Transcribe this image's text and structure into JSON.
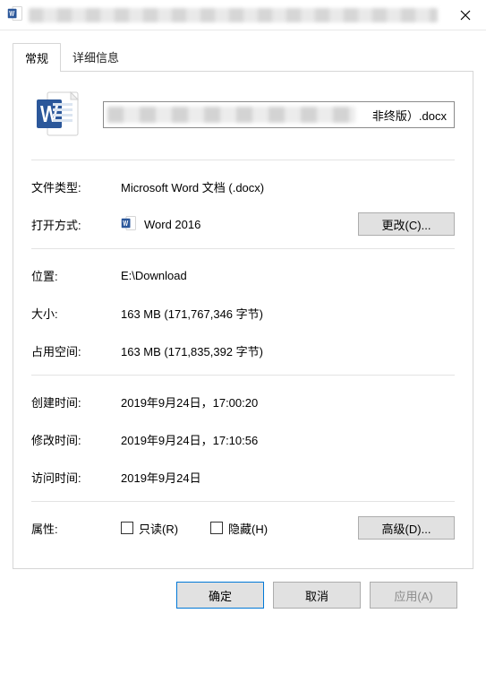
{
  "window": {
    "close_label": "✕"
  },
  "tabs": {
    "general": "常规",
    "details": "详细信息"
  },
  "filename_visible": "非终版）.docx",
  "fields": {
    "type_label": "文件类型:",
    "type_value": "Microsoft Word 文档 (.docx)",
    "open_with_label": "打开方式:",
    "open_with_value": "Word 2016",
    "change_btn": "更改(C)...",
    "location_label": "位置:",
    "location_value": "E:\\Download",
    "size_label": "大小:",
    "size_value": "163 MB (171,767,346 字节)",
    "size_on_disk_label": "占用空间:",
    "size_on_disk_value": "163 MB (171,835,392 字节)",
    "created_label": "创建时间:",
    "created_value": "2019年9月24日，17:00:20",
    "modified_label": "修改时间:",
    "modified_value": "2019年9月24日，17:10:56",
    "accessed_label": "访问时间:",
    "accessed_value": "2019年9月24日",
    "attributes_label": "属性:",
    "readonly_label": "只读(R)",
    "hidden_label": "隐藏(H)",
    "advanced_btn": "高级(D)..."
  },
  "footer": {
    "ok": "确定",
    "cancel": "取消",
    "apply": "应用(A)"
  }
}
